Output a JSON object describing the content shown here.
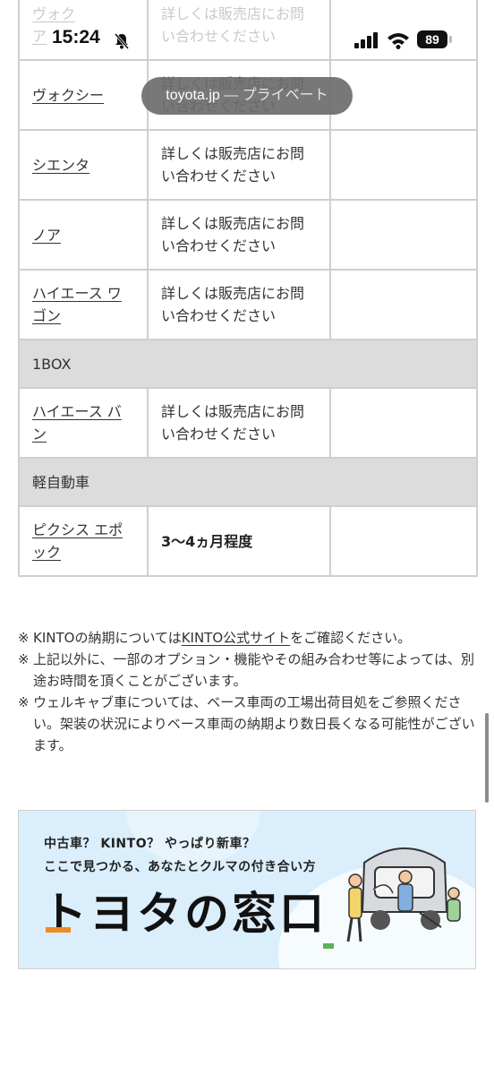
{
  "status_bar": {
    "time": "15:24",
    "battery": "89"
  },
  "url_pill": {
    "domain": "toyota.jp",
    "suffix": " — プライベート"
  },
  "table": {
    "rows": [
      {
        "type": "model",
        "model": "ヴォクシー",
        "delivery": "詳しくは販売店にお問い合わせください",
        "faded": true,
        "model_visible": "ヴォク\nア"
      },
      {
        "type": "model",
        "model": "ヴォクシー",
        "delivery": "詳しくは販売店にお問い合わせください"
      },
      {
        "type": "model",
        "model": "シエンタ",
        "delivery": "詳しくは販売店にお問い合わせください"
      },
      {
        "type": "model",
        "model": "ノア",
        "delivery": "詳しくは販売店にお問い合わせください"
      },
      {
        "type": "model",
        "model": "ハイエース ワゴン",
        "delivery": "詳しくは販売店にお問い合わせください"
      },
      {
        "type": "category",
        "label": "1BOX"
      },
      {
        "type": "model",
        "model": "ハイエース バン",
        "delivery": "詳しくは販売店にお問い合わせください"
      },
      {
        "type": "category",
        "label": "軽自動車"
      },
      {
        "type": "model",
        "model": "ピクシス エポック",
        "delivery": "3〜4ヵ月程度",
        "bold": true
      }
    ]
  },
  "notes": {
    "n1_prefix": "KINTOの納期については",
    "n1_link": "KINTO公式サイト",
    "n1_suffix": "をご確認ください。",
    "n2": "上記以外に、一部のオプション・機能やその組み合わせ等によっては、別途お時間を頂くことがございます。",
    "n3": "ウェルキャブ車については、ベース車両の工場出荷目処をご参照ください。架装の状況によりベース車両の納期より数日長くなる可能性がございます。",
    "mark": "※"
  },
  "banner": {
    "line1": "中古車？ KINTO？ やっぱり新車？",
    "line2": "ここで見つかる、あなたとクルマの付き合い方",
    "logo": "トヨタの窓口"
  },
  "colors": {
    "cell_border": "#cfcfcf",
    "category_bg": "#dcdcdc",
    "banner_bg": "#dbeefb"
  }
}
